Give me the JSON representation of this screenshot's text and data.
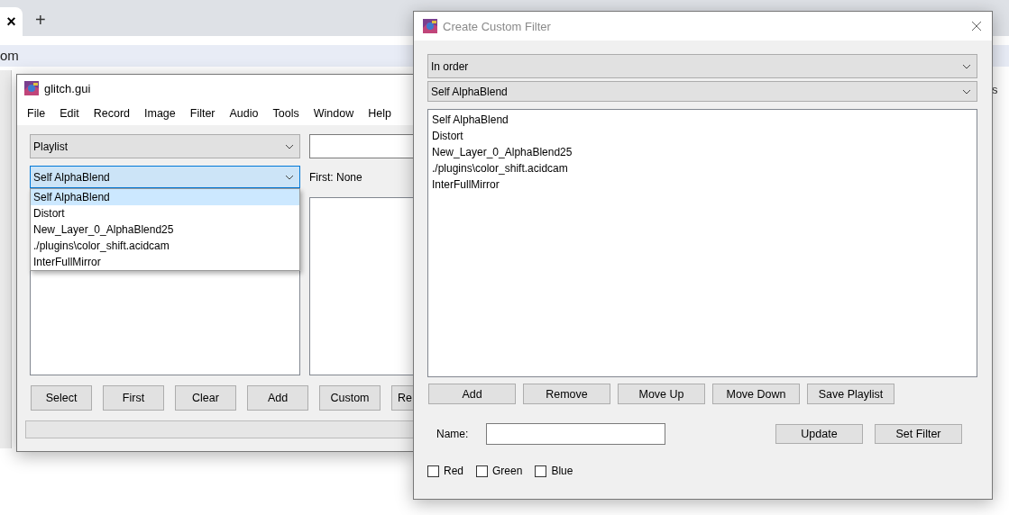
{
  "browser": {
    "tab_close": "×",
    "new_tab": "+",
    "address": "om",
    "page_fragment": "s"
  },
  "main_window": {
    "title": "glitch.gui",
    "menu": [
      "File",
      "Edit",
      "Record",
      "Image",
      "Filter",
      "Audio",
      "Tools",
      "Window",
      "Help"
    ],
    "playlist_combo": "Playlist",
    "filter_combo": "Self AlphaBlend",
    "dropdown": [
      {
        "label": "Self AlphaBlend",
        "selected": true
      },
      {
        "label": "Distort",
        "selected": false
      },
      {
        "label": "New_Layer_0_AlphaBlend25",
        "selected": false
      },
      {
        "label": "./plugins\\color_shift.acidcam",
        "selected": false
      },
      {
        "label": "InterFullMirror",
        "selected": false
      }
    ],
    "first_label": "First: None",
    "buttons": [
      "Select",
      "First",
      "Clear",
      "Add",
      "Custom",
      "Re"
    ],
    "progress": {
      "level": 0
    }
  },
  "dialog": {
    "title": "Create Custom Filter",
    "order_combo": "In order",
    "filter_combo": "Self AlphaBlend",
    "filters": [
      "Self AlphaBlend",
      "Distort",
      "New_Layer_0_AlphaBlend25",
      "./plugins\\color_shift.acidcam",
      "InterFullMirror"
    ],
    "buttons": [
      "Add",
      "Remove",
      "Move Up",
      "Move Down",
      "Save Playlist"
    ],
    "name_label": "Name:",
    "actions": [
      "Update",
      "Set Filter"
    ],
    "checkboxes": [
      {
        "label": "Red",
        "checked": false
      },
      {
        "label": "Green",
        "checked": false
      },
      {
        "label": "Blue",
        "checked": false
      }
    ]
  }
}
